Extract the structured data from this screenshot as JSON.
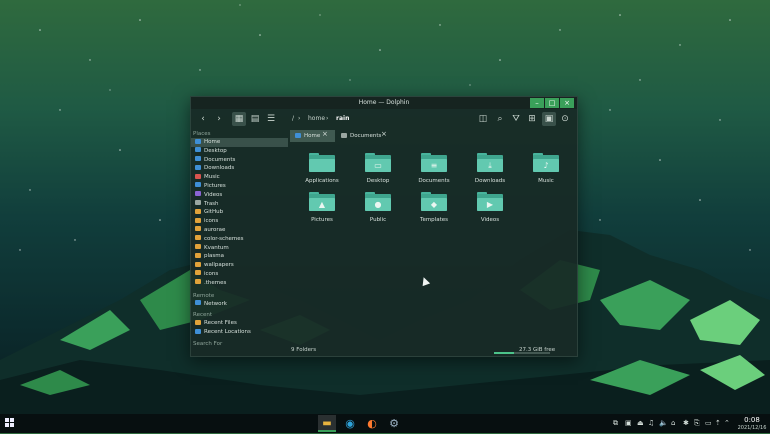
{
  "window": {
    "title": "Home — Dolphin",
    "min_label": "–",
    "max_label": "□",
    "close_label": "×"
  },
  "toolbar": {
    "back_icon": "‹",
    "forward_icon": "›",
    "icons_view_icon": "▦",
    "compact_view_icon": "▤",
    "details_view_icon": "☰",
    "split_icon": "◫",
    "search_icon": "⌕",
    "filter_icon": "⛛",
    "grid_icon": "⊞",
    "preview_icon": "▣",
    "menu_icon": "⊙",
    "breadcrumb_root": "/",
    "breadcrumb_home": "home",
    "breadcrumb_current": "rain",
    "chevron": "›"
  },
  "sidebar": {
    "places_title": "Places",
    "places": [
      {
        "label": "Home",
        "icon": "home-icon"
      },
      {
        "label": "Desktop",
        "icon": "desktop-icon"
      },
      {
        "label": "Documents",
        "icon": "documents-icon"
      },
      {
        "label": "Downloads",
        "icon": "downloads-icon"
      },
      {
        "label": "Music",
        "icon": "music-icon"
      },
      {
        "label": "Pictures",
        "icon": "pictures-icon"
      },
      {
        "label": "Videos",
        "icon": "videos-icon"
      },
      {
        "label": "Trash",
        "icon": "trash-icon"
      },
      {
        "label": "GitHub",
        "icon": "folder-icon"
      },
      {
        "label": "icons",
        "icon": "folder-icon"
      },
      {
        "label": "aurorae",
        "icon": "folder-icon"
      },
      {
        "label": "color-schemes",
        "icon": "folder-icon"
      },
      {
        "label": "Kvantum",
        "icon": "folder-icon"
      },
      {
        "label": "plasma",
        "icon": "folder-icon"
      },
      {
        "label": "wallpapers",
        "icon": "folder-icon"
      },
      {
        "label": "icons",
        "icon": "folder-icon"
      },
      {
        "label": ".themes",
        "icon": "folder-icon"
      }
    ],
    "remote_title": "Remote",
    "remote": [
      {
        "label": "Network",
        "icon": "network-icon"
      }
    ],
    "recent_title": "Recent",
    "recent": [
      {
        "label": "Recent Files",
        "icon": "recent-files-icon"
      },
      {
        "label": "Recent Locations",
        "icon": "recent-locations-icon"
      }
    ],
    "search_title": "Search For"
  },
  "tabs": [
    {
      "label": "Home",
      "icon": "home-icon",
      "close": "×"
    },
    {
      "label": "Documents",
      "icon": "document-icon",
      "close": "×"
    }
  ],
  "folders": [
    {
      "label": "Applications",
      "glyph": ""
    },
    {
      "label": "Desktop",
      "glyph": "▭"
    },
    {
      "label": "Documents",
      "glyph": "≡"
    },
    {
      "label": "Downloads",
      "glyph": "⤓"
    },
    {
      "label": "Music",
      "glyph": "♪"
    },
    {
      "label": "Pictures",
      "glyph": "▲"
    },
    {
      "label": "Public",
      "glyph": "●"
    },
    {
      "label": "Templates",
      "glyph": "◆"
    },
    {
      "label": "Videos",
      "glyph": "▶"
    }
  ],
  "status": {
    "folders_count": "9 Folders",
    "free_space": "27.3 GiB free",
    "free_fraction": 0.35
  },
  "taskbar": {
    "apps": [
      {
        "name": "file-manager-icon",
        "glyph": "▬",
        "color": "#e7b33e",
        "active": true
      },
      {
        "name": "edge-browser-icon",
        "glyph": "◉",
        "color": "#2fa3d9",
        "active": false
      },
      {
        "name": "firefox-icon",
        "glyph": "◐",
        "color": "#ff7a2f",
        "active": false
      },
      {
        "name": "settings-icon",
        "glyph": "⚙",
        "color": "#9fb6c9",
        "active": false
      }
    ],
    "tray": [
      "⧉",
      "▣",
      "⏏",
      "♫",
      "🔈",
      "⌂",
      "✱",
      "⎘",
      "▭",
      "⇡",
      "⌃"
    ],
    "time": "0:08",
    "date": "2021/12/16"
  },
  "colors": {
    "accent": "#3aa05a",
    "folder": "#4cb39a",
    "window_bg": "#182a26"
  }
}
